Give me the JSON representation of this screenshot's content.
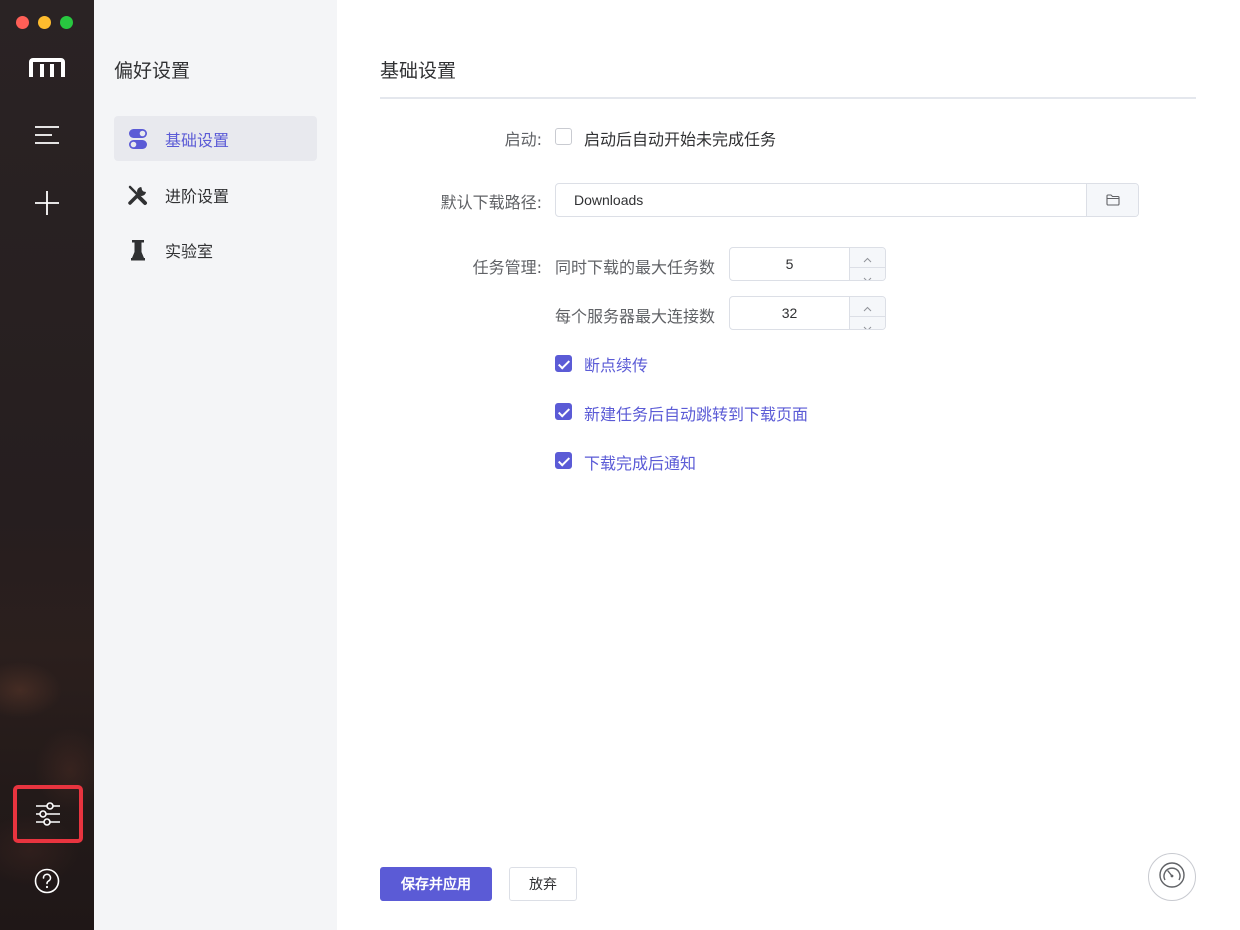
{
  "rail": {
    "logo_icon": "m-logo-icon",
    "items": [
      {
        "icon": "menu-icon",
        "name": "tasks"
      },
      {
        "icon": "plus-icon",
        "name": "add-task"
      },
      {
        "icon": "sliders-icon",
        "name": "preferences"
      },
      {
        "icon": "help-icon",
        "name": "help"
      }
    ]
  },
  "subnav": {
    "title": "偏好设置",
    "items": [
      {
        "label": "基础设置",
        "icon": "toggle-icon",
        "active": true
      },
      {
        "label": "进阶设置",
        "icon": "tools-icon",
        "active": false
      },
      {
        "label": "实验室",
        "icon": "flask-icon",
        "active": false
      }
    ]
  },
  "main": {
    "title": "基础设置",
    "startup": {
      "label": "启动:",
      "option": "启动后自动开始未完成任务",
      "checked": false
    },
    "download_path": {
      "label": "默认下载路径:",
      "value": "Downloads",
      "browse_icon": "folder-icon"
    },
    "task_management": {
      "label": "任务管理:",
      "max_tasks_label": "同时下载的最大任务数",
      "max_tasks_value": "5",
      "max_conn_label": "每个服务器最大连接数",
      "max_conn_value": "32",
      "options": [
        {
          "label": "断点续传",
          "checked": true
        },
        {
          "label": "新建任务后自动跳转到下载页面",
          "checked": true
        },
        {
          "label": "下载完成后通知",
          "checked": true
        }
      ]
    },
    "buttons": {
      "save": "保存并应用",
      "discard": "放弃"
    },
    "speed_icon": "speedometer-icon"
  },
  "colors": {
    "accent": "#5b5bd6",
    "highlight_border": "#e8343f"
  }
}
